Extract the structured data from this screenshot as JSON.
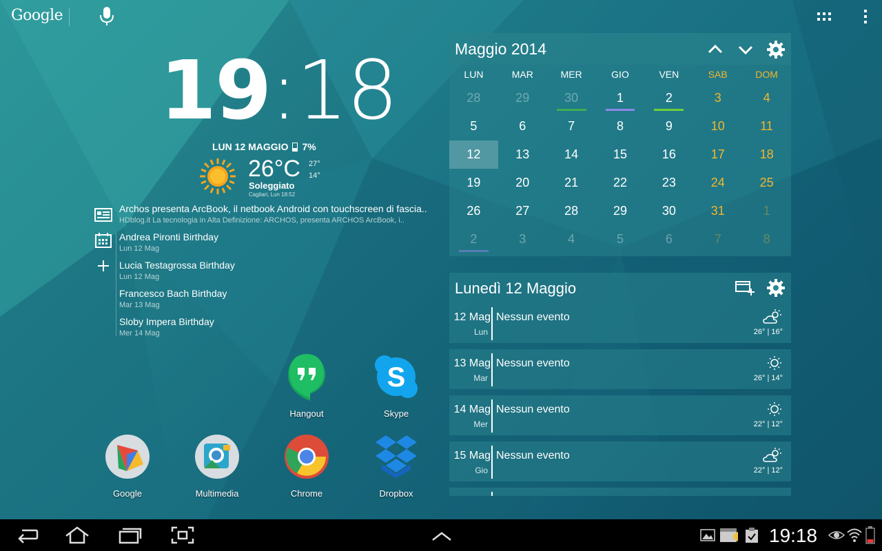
{
  "topbar": {
    "google_label": "Google",
    "icons": [
      "mic-icon",
      "apps-grid-icon",
      "overflow-menu-icon"
    ]
  },
  "clock": {
    "hours": "19",
    "separator": ":",
    "minutes": "18",
    "date": "LUN 12 MAGGIO",
    "battery": "7%"
  },
  "weather": {
    "temp": "26°C",
    "high": "27°",
    "low": "14°",
    "condition": "Soleggiato",
    "location": "Cagliari, Lun 18:52",
    "icon": "sun-icon"
  },
  "feed": [
    {
      "title": "Archos presenta ArcBook, il netbook Android con touchscreen di fascia..",
      "sub": "HDblog.it La tecnologia in Alta Definizione: ARCHOS, presenta ARCHOS ArcBook, i.."
    },
    {
      "title": "Andrea Pironti Birthday",
      "sub": "Lun 12 Mag"
    },
    {
      "title": "Lucia Testagrossa Birthday",
      "sub": "Lun 12 Mag"
    },
    {
      "title": "Francesco Bach Birthday",
      "sub": "Mar 13 Mag"
    },
    {
      "title": "Sloby Impera Birthday",
      "sub": "Mer 14 Mag"
    }
  ],
  "apps": {
    "hangout": "Hangout",
    "skype": "Skype",
    "google": "Google",
    "multimedia": "Multimedia",
    "chrome": "Chrome",
    "dropbox": "Dropbox"
  },
  "calendar": {
    "title": "Maggio 2014",
    "dow": [
      "LUN",
      "MAR",
      "MER",
      "GIO",
      "VEN",
      "SAB",
      "DOM"
    ],
    "weeks": [
      [
        "28",
        "29",
        "30",
        "1",
        "2",
        "3",
        "4"
      ],
      [
        "5",
        "6",
        "7",
        "8",
        "9",
        "10",
        "11"
      ],
      [
        "12",
        "13",
        "14",
        "15",
        "16",
        "17",
        "18"
      ],
      [
        "19",
        "20",
        "21",
        "22",
        "23",
        "24",
        "25"
      ],
      [
        "26",
        "27",
        "28",
        "29",
        "30",
        "31",
        "1"
      ],
      [
        "2",
        "3",
        "4",
        "5",
        "6",
        "7",
        "8"
      ]
    ],
    "weekend_color": "#f2b62d"
  },
  "agenda": {
    "title": "Lunedì 12 Maggio",
    "rows": [
      {
        "date": "12 Mag",
        "day": "Lun",
        "event": "Nessun evento",
        "temps": "26° | 16°",
        "icon": "partly-cloudy-icon"
      },
      {
        "date": "13 Mag",
        "day": "Mar",
        "event": "Nessun evento",
        "temps": "26° | 14°",
        "icon": "sunny-icon"
      },
      {
        "date": "14 Mag",
        "day": "Mer",
        "event": "Nessun evento",
        "temps": "22° | 12°",
        "icon": "sunny-icon"
      },
      {
        "date": "15 Mag",
        "day": "Gio",
        "event": "Nessun evento",
        "temps": "22° | 12°",
        "icon": "partly-cloudy-icon"
      }
    ]
  },
  "statusbar": {
    "time": "19:18"
  }
}
